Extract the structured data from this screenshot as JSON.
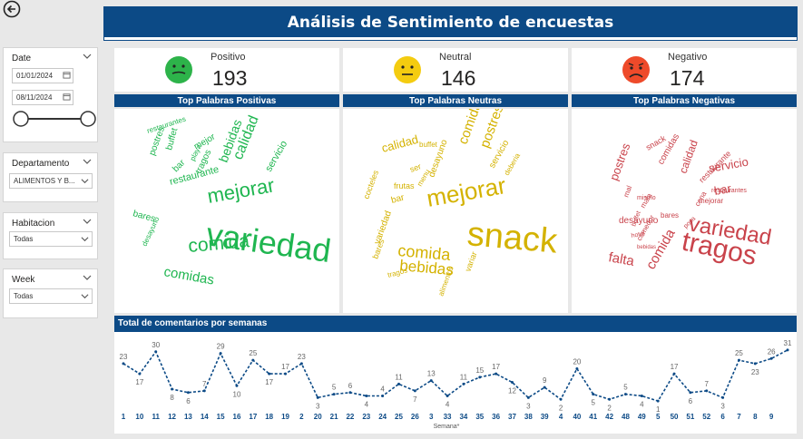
{
  "title": "Análisis de Sentimiento de encuestas",
  "filters": {
    "date": {
      "label": "Date",
      "start": "01/01/2024",
      "end": "08/11/2024"
    },
    "departamento": {
      "label": "Departamento",
      "value": "ALIMENTOS Y B..."
    },
    "habitacion": {
      "label": "Habitacion",
      "value": "Todas"
    },
    "week": {
      "label": "Week",
      "value": "Todas"
    }
  },
  "kpis": [
    {
      "label": "Positivo",
      "value": "193",
      "color": "#2db34a"
    },
    {
      "label": "Neutral",
      "value": "146",
      "color": "#f4cc10"
    },
    {
      "label": "Negativo",
      "value": "174",
      "color": "#ee4a2a"
    }
  ],
  "panels": [
    {
      "title": "Top Palabras Positivas",
      "color": "#1fb650",
      "words": [
        "restaurantes",
        "postres",
        "buffet",
        "mejor",
        "playa",
        "bebidas",
        "calidad",
        "bar",
        "tragos",
        "restaurante",
        "servicio",
        "mejorar",
        "variedad",
        "bares",
        "comida",
        "desayuno",
        "comidas"
      ]
    },
    {
      "title": "Top Palabras Neutras",
      "color": "#d4b200",
      "words": [
        "buffet",
        "comidas",
        "calidad",
        "postres",
        "desayuno",
        "servicio",
        "ser",
        "menu",
        "frutas",
        "cocteles",
        "bar",
        "mejorar",
        "deberia",
        "variedad",
        "snack",
        "bares",
        "comida",
        "bebidas",
        "variar",
        "tragos",
        "alimentos"
      ]
    },
    {
      "title": "Top Palabras Negativas",
      "color": "#c9434b",
      "words": [
        "postres",
        "snack",
        "servicio",
        "comidas",
        "calidad",
        "restaurante",
        "restaurantes",
        "bar",
        "mal",
        "mismo",
        "mala",
        "mejorar",
        "variedad",
        "desayuno",
        "bares",
        "buffet",
        "poca",
        "hotel",
        "comedor",
        "cena",
        "bebidas",
        "falta",
        "comida",
        "tragos"
      ]
    }
  ],
  "line_chart": {
    "title": "Total de comentarios por semanas",
    "xlabel": "Semana*",
    "color": "#0c4a86"
  },
  "chart_data": {
    "type": "line",
    "title": "Total de comentarios por semanas",
    "xlabel": "Semana*",
    "categories": [
      "1",
      "10",
      "11",
      "12",
      "13",
      "14",
      "15",
      "16",
      "17",
      "18",
      "19",
      "2",
      "20",
      "21",
      "22",
      "23",
      "24",
      "25",
      "26",
      "3",
      "33",
      "34",
      "35",
      "36",
      "37",
      "38",
      "39",
      "4",
      "40",
      "41",
      "42",
      "48",
      "49",
      "5",
      "50",
      "51",
      "52",
      "6",
      "7",
      "8",
      "9"
    ],
    "values": [
      23,
      17,
      30,
      8,
      6,
      7,
      29,
      10,
      25,
      17,
      17,
      23,
      3,
      5,
      6,
      4,
      4,
      11,
      7,
      13,
      4,
      11,
      15,
      17,
      12,
      3,
      9,
      2,
      20,
      5,
      2,
      5,
      4,
      1,
      17,
      6,
      7,
      3,
      25,
      23,
      26,
      31
    ],
    "ylim": [
      0,
      32
    ]
  }
}
